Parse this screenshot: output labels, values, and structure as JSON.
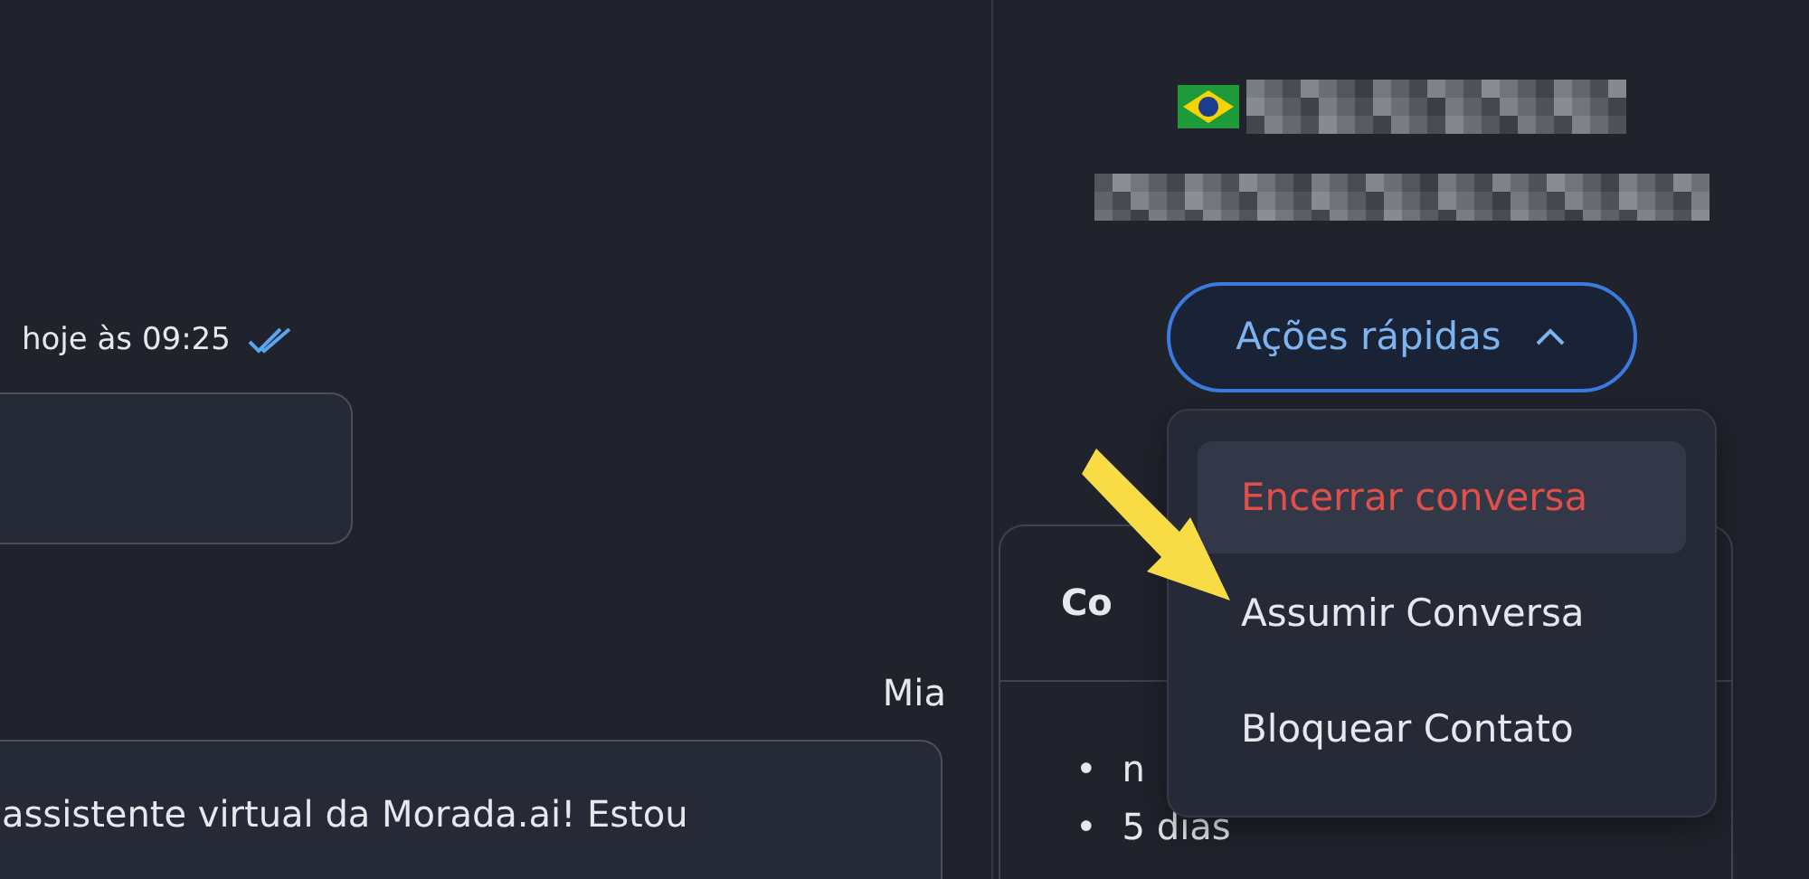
{
  "chat": {
    "timestamp": "hoje às 09:25",
    "read": true,
    "sender": "Mia",
    "message": "assistente virtual da Morada.ai! Estou"
  },
  "contact": {
    "quick_actions": {
      "label": "Ações rápidas",
      "expanded": true,
      "items": [
        {
          "label": "Encerrar conversa",
          "kind": "danger",
          "selected": true
        },
        {
          "label": "Assumir Conversa",
          "kind": "normal",
          "selected": false
        },
        {
          "label": "Bloquear Contato",
          "kind": "normal",
          "selected": false
        }
      ]
    },
    "card": {
      "title": "Co",
      "items": [
        {
          "bullet": "•",
          "text": "n"
        },
        {
          "bullet": "•",
          "text": "5 dias"
        }
      ]
    }
  }
}
